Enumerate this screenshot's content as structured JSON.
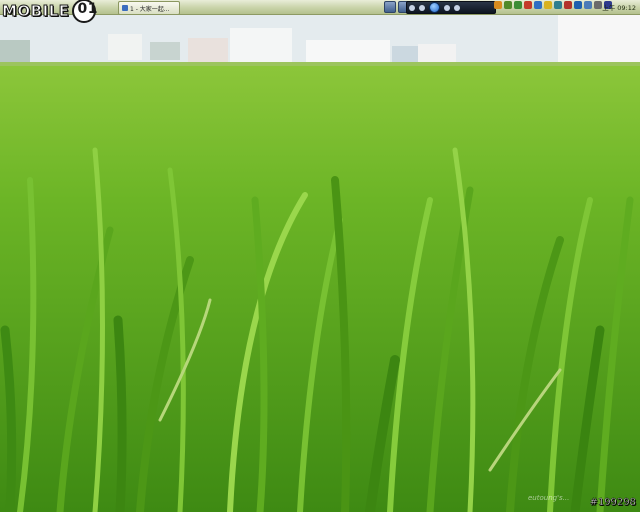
{
  "desktop": {
    "wallpaper": "rice-field-wallpaper"
  },
  "taskbar": {
    "active_task": {
      "label": "1 - 大家一起...",
      "icon": "window-icon"
    },
    "clock": "上午 09:12",
    "media_controls": [
      "prev-icon",
      "next-icon"
    ],
    "player_controls": [
      "stop-icon",
      "prev-track-icon",
      "play-icon",
      "next-track-icon",
      "volume-icon"
    ],
    "tray_icons": [
      {
        "name": "ie-icon",
        "color": "#d98c1e"
      },
      {
        "name": "network-icon",
        "color": "#4f8a2a"
      },
      {
        "name": "messenger-icon",
        "color": "#3c8d35"
      },
      {
        "name": "antivirus-icon",
        "color": "#c43a2a"
      },
      {
        "name": "update-icon",
        "color": "#2e6fc4"
      },
      {
        "name": "chat-icon",
        "color": "#d8b21e"
      },
      {
        "name": "sync-icon",
        "color": "#2f7f8f"
      },
      {
        "name": "shield-icon",
        "color": "#b2342a"
      },
      {
        "name": "app-icon",
        "color": "#1f5fae"
      },
      {
        "name": "cloud-icon",
        "color": "#4b7bb8"
      },
      {
        "name": "sound-icon",
        "color": "#6b6b6b"
      },
      {
        "name": "security-icon",
        "color": "#2e3a8c"
      }
    ]
  },
  "watermark": {
    "logo_text": "MOBILE",
    "logo_number": "01",
    "signature": "eutoung's...",
    "post_id": "#199298"
  }
}
